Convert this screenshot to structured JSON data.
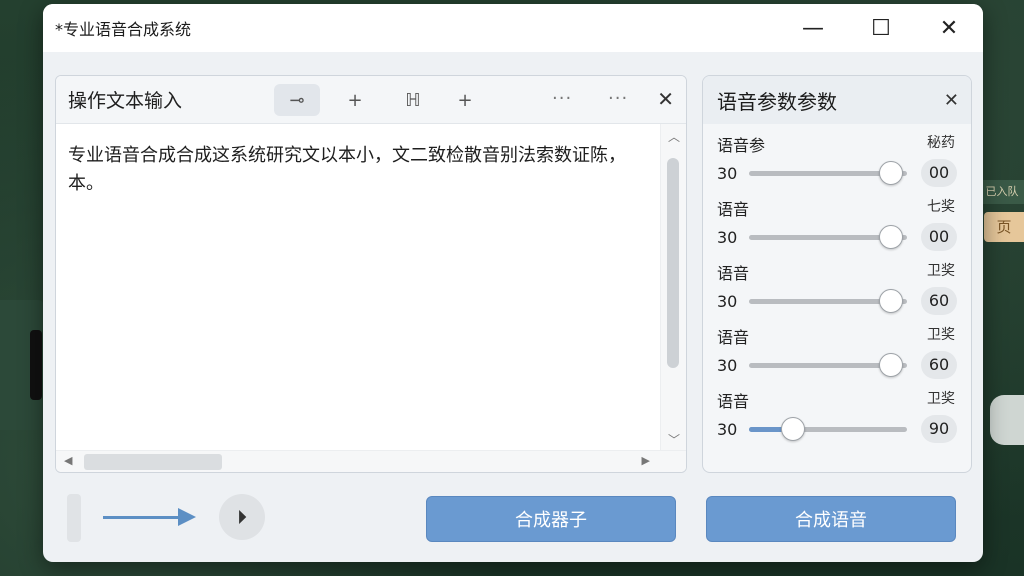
{
  "window": {
    "title": "*专业语音合成系统",
    "minimize_icon": "—",
    "maximize_icon": "☐",
    "close_icon": "✕"
  },
  "editor": {
    "title": "操作文本输入",
    "tools": [
      "⊸",
      "+",
      "ℍ",
      "+"
    ],
    "more_icon": "···",
    "close_icon": "✕",
    "text_line1": "专业语音合成合成这系统研究文以本小，文二致检散音别法索数证陈，",
    "text_line2": "本。"
  },
  "params": {
    "title": "语音参数参数",
    "close_icon": "✕",
    "items": [
      {
        "name": "语音参",
        "tag": "秘药",
        "min": "30",
        "value": "00",
        "level": 0.9
      },
      {
        "name": "语音",
        "tag": "七奖",
        "min": "30",
        "value": "00",
        "level": 0.9
      },
      {
        "name": "语音",
        "tag": "卫奖",
        "min": "30",
        "value": "60",
        "level": 0.9
      },
      {
        "name": "语音",
        "tag": "卫奖",
        "min": "30",
        "value": "60",
        "level": 0.9
      },
      {
        "name": "语音",
        "tag": "卫奖",
        "min": "30",
        "value": "90",
        "level": 0.28
      }
    ]
  },
  "bottom": {
    "play_icon": "⏵",
    "btn_left": "合成器子",
    "btn_right": "合成语音"
  },
  "background": {
    "tag_text": "已入队",
    "btn_text": "页"
  },
  "colors": {
    "accent": "#6a9ad1",
    "slider_fill": "#6a95c9"
  }
}
